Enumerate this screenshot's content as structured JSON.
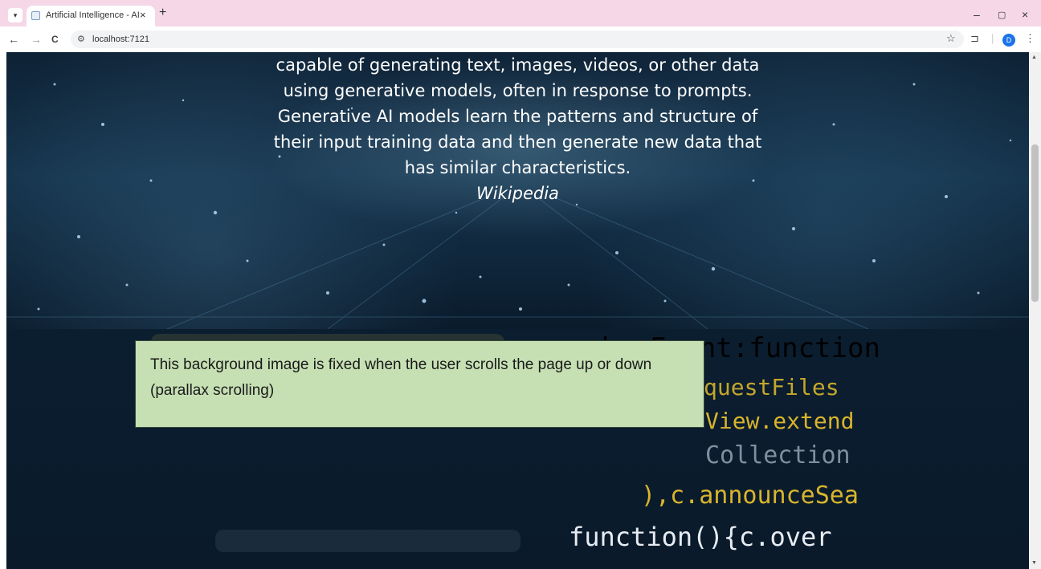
{
  "browser": {
    "tab_search_icon": "chevron-down-icon",
    "tab_title": "Artificial Intelligence - AI",
    "tab_close": "×",
    "new_tab": "+",
    "minimize": "–",
    "maximize": "▢",
    "close": "×",
    "back": "←",
    "forward": "→",
    "reload": "C",
    "site_info": "⚙",
    "url": "localhost:7121",
    "bookmark": "☆",
    "extensions": "⊐",
    "profile_initial": "D",
    "menu": "⋮"
  },
  "hero": {
    "lines": [
      "capable of generating text, images, videos, or other data",
      "using generative models, often in response to prompts.",
      "Generative AI models learn the patterns and structure of",
      "their input training data and then generate new data that",
      "has similar characteristics."
    ],
    "source": "Wikipedia"
  },
  "code_background": {
    "lines": [
      {
        "text": "keyEvent:function",
        "color": "#e6ecf2"
      },
      {
        "text": "maybeRequestFiles",
        "color": "#d9b52c"
      },
      {
        "text": "View.extend",
        "color": "#d9b52c"
      },
      {
        "text": "Collection",
        "color": "#7f8fa0"
      },
      {
        "text": "),c.announceSea",
        "color": "#d9b52c"
      },
      {
        "text": "function(){c.over",
        "color": "#e6ecf2"
      }
    ]
  },
  "callout": {
    "text": "This background image is fixed when the user scrolls the page up or down (parallax scrolling)"
  },
  "colors": {
    "tabstrip": "#f5d7e8",
    "callout_bg": "#c6e0b4",
    "code_yellow": "#d9b52c",
    "hero_text": "#ffffff"
  },
  "scrollbar": {
    "up_arrow": "▲",
    "down_arrow": "▼"
  }
}
